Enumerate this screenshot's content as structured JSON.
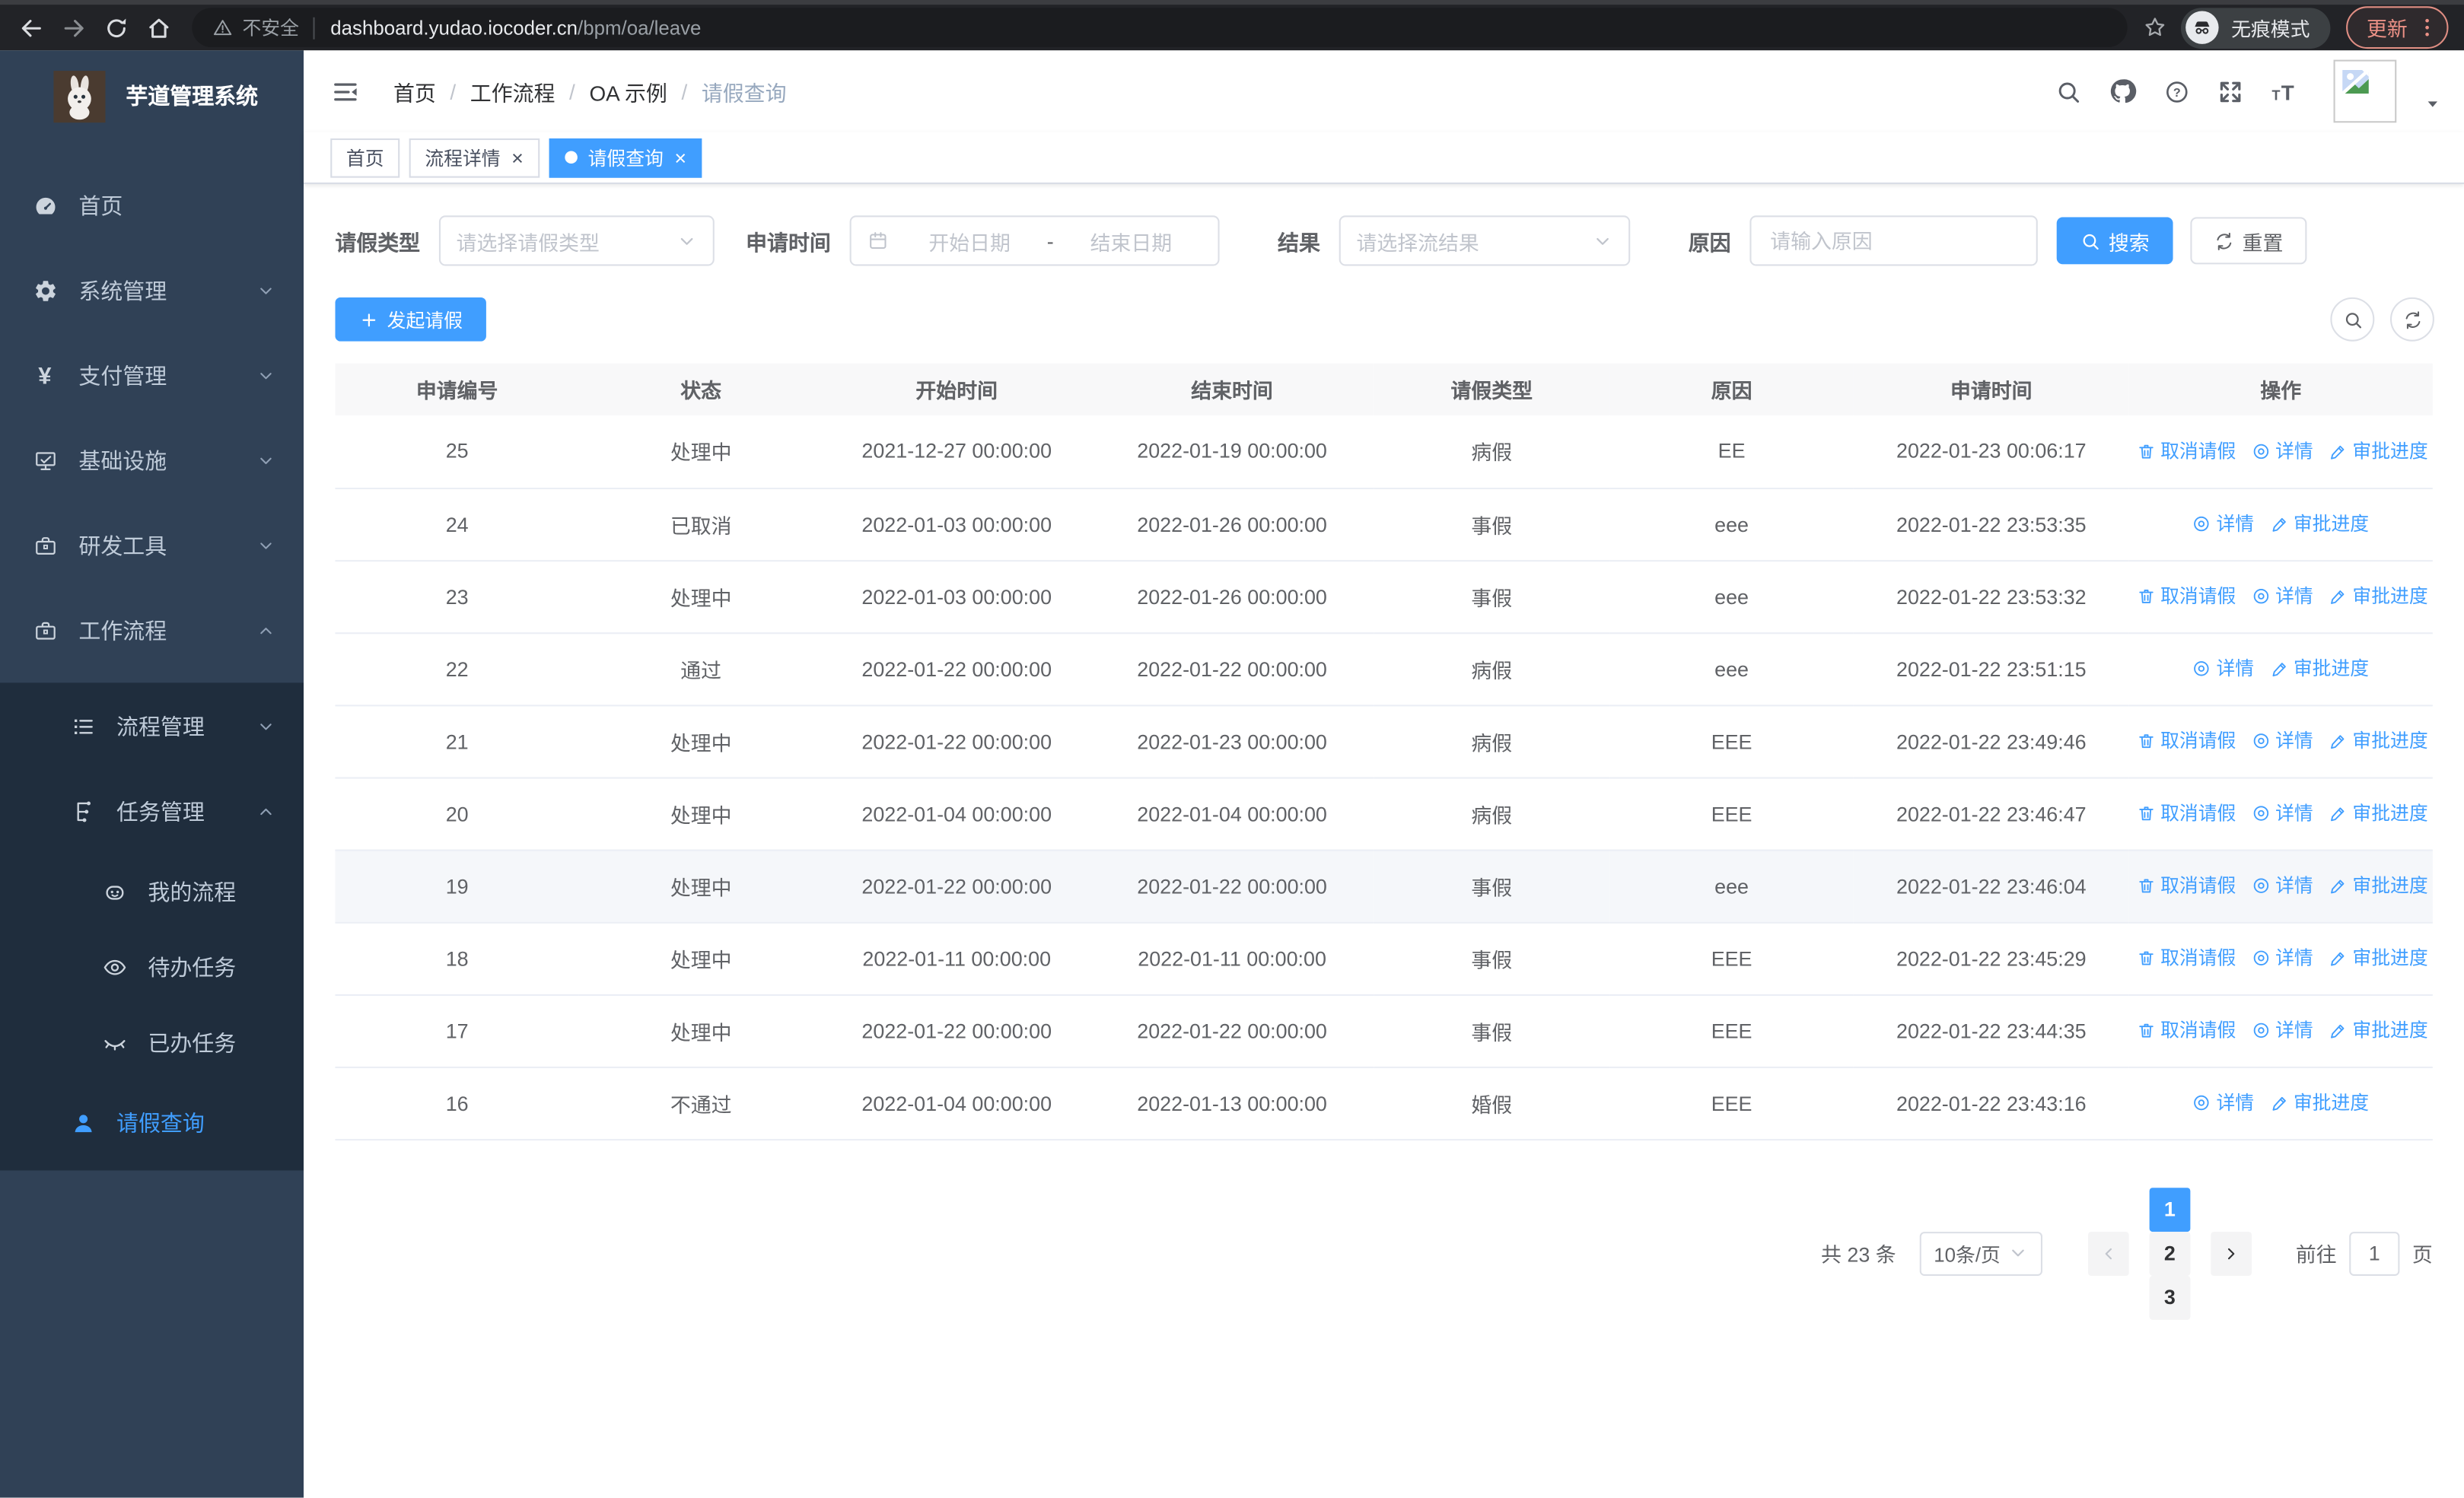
{
  "browser": {
    "nav_icons": [
      "back",
      "forward",
      "reload",
      "home"
    ],
    "security_warning": "不安全",
    "url_host": "dashboard.yudao.iocoder.cn",
    "url_path": "/bpm/oa/leave",
    "bookmark_icon": "star",
    "incognito_label": "无痕模式",
    "update_label": "更新",
    "menu_icon": "kebab-dots",
    "update_color": "#ec9186"
  },
  "sidebar": {
    "app_title": "芋道管理系统",
    "top_items": [
      {
        "label": "首页",
        "icon": "dashboard",
        "level": 1
      },
      {
        "label": "系统管理",
        "icon": "gear",
        "level": 1,
        "chevron": "down"
      },
      {
        "label": "支付管理",
        "icon": "yen",
        "level": 1,
        "chevron": "down"
      },
      {
        "label": "基础设施",
        "icon": "monitor",
        "level": 1,
        "chevron": "down"
      },
      {
        "label": "研发工具",
        "icon": "toolbox",
        "level": 1,
        "chevron": "down"
      },
      {
        "label": "工作流程",
        "icon": "briefcase",
        "level": 1,
        "chevron": "up"
      }
    ],
    "workflow_children": [
      {
        "label": "流程管理",
        "icon": "list",
        "level": 2,
        "chevron": "down"
      },
      {
        "label": "任务管理",
        "icon": "tree",
        "level": 2,
        "chevron": "up"
      },
      {
        "label": "我的流程",
        "icon": "robot",
        "level": 3
      },
      {
        "label": "待办任务",
        "icon": "eye",
        "level": 3
      },
      {
        "label": "已办任务",
        "icon": "eye-closed",
        "level": 3
      },
      {
        "label": "请假查询",
        "icon": "user",
        "level": 2,
        "active": true
      }
    ]
  },
  "header": {
    "breadcrumb": [
      "首页",
      "工作流程",
      "OA 示例",
      "请假查询"
    ],
    "nav_icons": [
      "search",
      "github",
      "question",
      "fullscreen",
      "font-size"
    ],
    "tabs": [
      {
        "label": "首页",
        "closable": false,
        "active": false
      },
      {
        "label": "流程详情",
        "closable": true,
        "active": false
      },
      {
        "label": "请假查询",
        "closable": true,
        "active": true
      }
    ]
  },
  "filters": {
    "leave_type_label": "请假类型",
    "leave_type_placeholder": "请选择请假类型",
    "apply_time_label": "申请时间",
    "start_date_placeholder": "开始日期",
    "range_separator": "-",
    "end_date_placeholder": "结束日期",
    "result_label": "结果",
    "result_placeholder": "请选择流结果",
    "reason_label": "原因",
    "reason_placeholder": "请输入原因",
    "search_label": "搜索",
    "reset_label": "重置"
  },
  "toolbar": {
    "create_label": "发起请假",
    "right_icons": [
      "search",
      "refresh"
    ]
  },
  "table": {
    "columns": [
      "申请编号",
      "状态",
      "开始时间",
      "结束时间",
      "请假类型",
      "原因",
      "申请时间",
      "操作"
    ],
    "action_labels": {
      "cancel": "取消请假",
      "detail": "详情",
      "progress": "审批进度"
    },
    "action_icons": {
      "cancel": "trash",
      "detail": "eye-circle",
      "progress": "pen"
    },
    "rows": [
      {
        "id": "25",
        "status": "处理中",
        "start": "2021-12-27 00:00:00",
        "end": "2022-01-19 00:00:00",
        "type": "病假",
        "reason": "EE",
        "applied": "2022-01-23 00:06:17",
        "actions": [
          "cancel",
          "detail",
          "progress"
        ]
      },
      {
        "id": "24",
        "status": "已取消",
        "start": "2022-01-03 00:00:00",
        "end": "2022-01-26 00:00:00",
        "type": "事假",
        "reason": "eee",
        "applied": "2022-01-22 23:53:35",
        "actions": [
          "detail",
          "progress"
        ]
      },
      {
        "id": "23",
        "status": "处理中",
        "start": "2022-01-03 00:00:00",
        "end": "2022-01-26 00:00:00",
        "type": "事假",
        "reason": "eee",
        "applied": "2022-01-22 23:53:32",
        "actions": [
          "cancel",
          "detail",
          "progress"
        ]
      },
      {
        "id": "22",
        "status": "通过",
        "start": "2022-01-22 00:00:00",
        "end": "2022-01-22 00:00:00",
        "type": "病假",
        "reason": "eee",
        "applied": "2022-01-22 23:51:15",
        "actions": [
          "detail",
          "progress"
        ]
      },
      {
        "id": "21",
        "status": "处理中",
        "start": "2022-01-22 00:00:00",
        "end": "2022-01-23 00:00:00",
        "type": "病假",
        "reason": "EEE",
        "applied": "2022-01-22 23:49:46",
        "actions": [
          "cancel",
          "detail",
          "progress"
        ]
      },
      {
        "id": "20",
        "status": "处理中",
        "start": "2022-01-04 00:00:00",
        "end": "2022-01-04 00:00:00",
        "type": "病假",
        "reason": "EEE",
        "applied": "2022-01-22 23:46:47",
        "actions": [
          "cancel",
          "detail",
          "progress"
        ]
      },
      {
        "id": "19",
        "status": "处理中",
        "start": "2022-01-22 00:00:00",
        "end": "2022-01-22 00:00:00",
        "type": "事假",
        "reason": "eee",
        "applied": "2022-01-22 23:46:04",
        "actions": [
          "cancel",
          "detail",
          "progress"
        ],
        "highlighted": true
      },
      {
        "id": "18",
        "status": "处理中",
        "start": "2022-01-11 00:00:00",
        "end": "2022-01-11 00:00:00",
        "type": "事假",
        "reason": "EEE",
        "applied": "2022-01-22 23:45:29",
        "actions": [
          "cancel",
          "detail",
          "progress"
        ]
      },
      {
        "id": "17",
        "status": "处理中",
        "start": "2022-01-22 00:00:00",
        "end": "2022-01-22 00:00:00",
        "type": "事假",
        "reason": "EEE",
        "applied": "2022-01-22 23:44:35",
        "actions": [
          "cancel",
          "detail",
          "progress"
        ]
      },
      {
        "id": "16",
        "status": "不通过",
        "start": "2022-01-04 00:00:00",
        "end": "2022-01-13 00:00:00",
        "type": "婚假",
        "reason": "EEE",
        "applied": "2022-01-22 23:43:16",
        "actions": [
          "detail",
          "progress"
        ]
      }
    ]
  },
  "pagination": {
    "total_label": "共 23 条",
    "page_size": "10条/页",
    "pages": [
      "1",
      "2",
      "3"
    ],
    "active_page": "1",
    "goto_label": "前往",
    "goto_value": "1",
    "goto_suffix": "页"
  },
  "colors": {
    "primary": "#409eff",
    "sidebar_bg": "#304156",
    "submenu_bg": "#1f2d3d"
  }
}
